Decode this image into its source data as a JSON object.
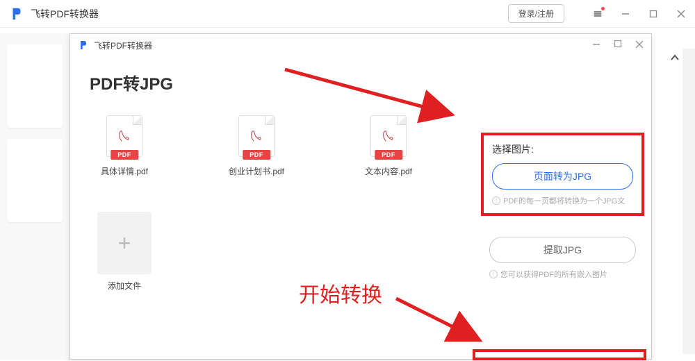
{
  "outerWindow": {
    "title": "飞转PDF转换器",
    "loginButton": "登录/注册"
  },
  "innerWindow": {
    "title": "飞转PDF转换器",
    "pageTitle": "PDF转JPG",
    "files": [
      {
        "name": "具体详情.pdf",
        "badge": "PDF"
      },
      {
        "name": "创业计划书.pdf",
        "badge": "PDF"
      },
      {
        "name": "文本内容.pdf",
        "badge": "PDF"
      }
    ],
    "addFile": "添加文件",
    "sidePanel": {
      "selectImageLabel": "选择图片:",
      "primaryBtn": "页面转为JPG",
      "primaryHint": "PDF的每一页都将转换为一个JPG文",
      "secondaryBtn": "提取JPG",
      "secondaryHint": "您可以获得PDF的所有嵌入图片"
    }
  },
  "annotations": {
    "startConvert": "开始转换"
  }
}
